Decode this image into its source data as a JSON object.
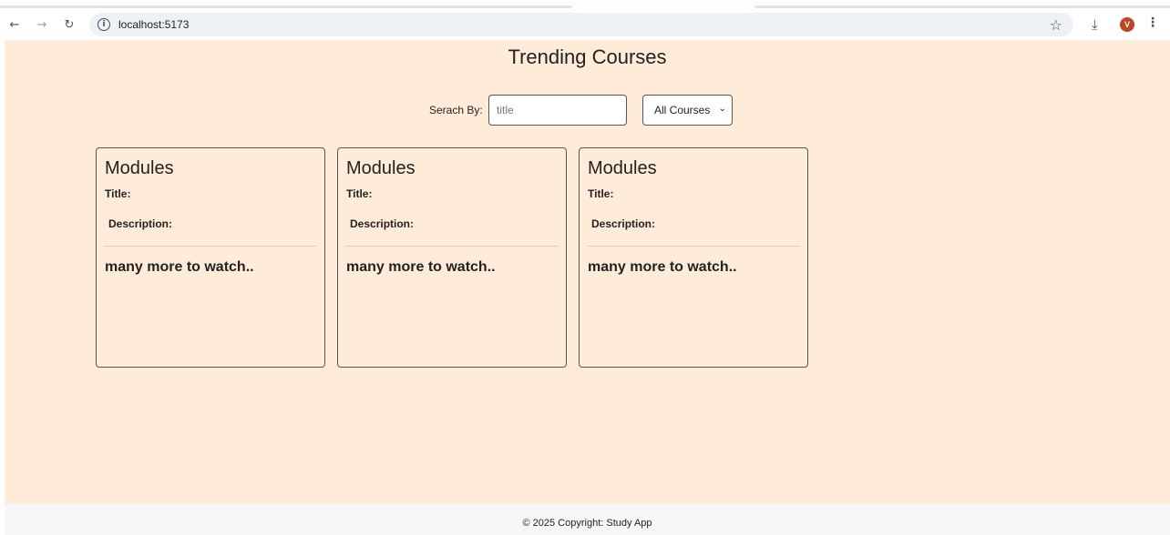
{
  "browser": {
    "url": "localhost:5173",
    "avatar_letter": "V",
    "icons": {
      "back": "arrow-left-icon",
      "forward": "arrow-right-icon",
      "reload": "reload-icon",
      "info": "info-icon",
      "star": "star-icon",
      "download": "download-icon",
      "menu": "kebab-menu-icon"
    }
  },
  "page": {
    "title": "Trending Courses",
    "search": {
      "label": "Serach By:",
      "placeholder": "title",
      "value": ""
    },
    "filter": {
      "selected": "All Courses"
    },
    "cards": [
      {
        "heading": "Modules",
        "title_label": "Title:",
        "description_label": "Description:",
        "more_text": "many more to watch.."
      },
      {
        "heading": "Modules",
        "title_label": "Title:",
        "description_label": "Description:",
        "more_text": "many more to watch.."
      },
      {
        "heading": "Modules",
        "title_label": "Title:",
        "description_label": "Description:",
        "more_text": "many more to watch.."
      }
    ]
  },
  "footer": {
    "text": "© 2025 Copyright: Study App"
  },
  "colors": {
    "page_background": "#feecd9",
    "footer_background": "#f6f7f9",
    "avatar": "#c5421f"
  }
}
